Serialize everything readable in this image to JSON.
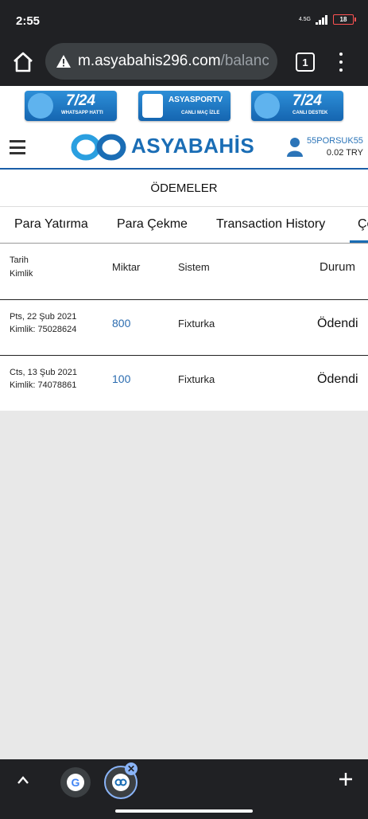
{
  "status": {
    "time": "2:55",
    "network": "4.5G",
    "battery": "18"
  },
  "browser": {
    "url_main": "m.asyabahis296.com",
    "url_rest": "/balanc",
    "tab_count": "1"
  },
  "banners": [
    {
      "big": "7/24",
      "small": "WHATSAPP HATTI"
    },
    {
      "big": "ASYASPORTV",
      "small": "CANLI MAÇ İZLE"
    },
    {
      "big": "7/24",
      "small": "CANLI DESTEK"
    }
  ],
  "header": {
    "logo_text": "ASYABAHİS",
    "username": "55PORSUK55",
    "balance": "0.02 TRY"
  },
  "section_title": "ÖDEMELER",
  "tabs": [
    {
      "label": "Para Yatırma"
    },
    {
      "label": "Para Çekme"
    },
    {
      "label": "Transaction History"
    },
    {
      "label": "Çe"
    }
  ],
  "table": {
    "headers": {
      "date": "Tarih",
      "id": "Kimlik",
      "amount": "Miktar",
      "system": "Sistem",
      "status": "Durum"
    },
    "rows": [
      {
        "date": "Pts, 22 Şub 2021",
        "id": "Kimlik: 75028624",
        "amount": "800",
        "system": "Fixturka",
        "status": "Ödendi"
      },
      {
        "date": "Cts, 13 Şub 2021",
        "id": "Kimlik: 74078861",
        "amount": "100",
        "system": "Fixturka",
        "status": "Ödendi"
      }
    ]
  },
  "colors": {
    "brand_blue": "#1a6db5",
    "amount_blue": "#2b6cb0",
    "chrome_dark": "#202124"
  },
  "icons": [
    "home-icon",
    "warning-icon",
    "tabs-icon",
    "more-vert-icon",
    "hamburger-icon",
    "user-icon",
    "chevron-up-icon",
    "google-icon",
    "plus-icon",
    "close-icon"
  ]
}
